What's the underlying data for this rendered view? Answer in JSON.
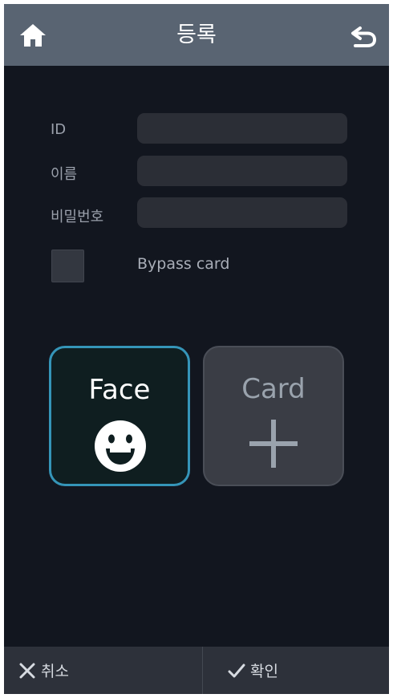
{
  "header": {
    "title": "등록",
    "home_icon": "home-icon",
    "back_icon": "undo-arrow-icon"
  },
  "form": {
    "id_label": "ID",
    "id_value": "",
    "name_label": "이름",
    "name_value": "",
    "password_label": "비밀번호",
    "password_value": ""
  },
  "bypass_card": {
    "label": "Bypass card",
    "checked": false
  },
  "tiles": {
    "face_label": "Face",
    "face_icon": "smiley-face-icon",
    "card_label": "Card",
    "card_icon": "plus-icon"
  },
  "footer": {
    "cancel_label": "취소",
    "confirm_label": "확인",
    "cancel_icon": "x-icon",
    "confirm_icon": "check-icon"
  },
  "colors": {
    "header_bg": "#596472",
    "body_bg": "#12161f",
    "face_tile_border": "#3595b8",
    "footer_bg": "#2d313a"
  }
}
